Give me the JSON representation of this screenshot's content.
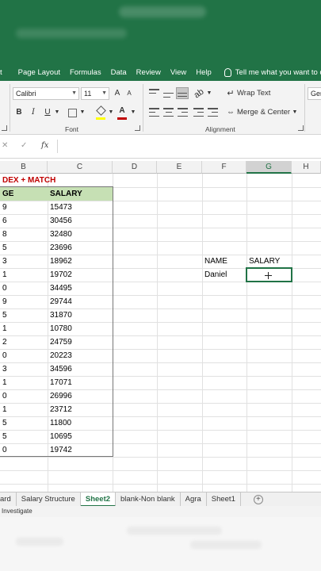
{
  "ribbon_tabs": [
    "t",
    "Page Layout",
    "Formulas",
    "Data",
    "Review",
    "View",
    "Help"
  ],
  "tell_me": "Tell me what you want to d",
  "font": {
    "name": "Calibri",
    "size": "11",
    "grow": "A",
    "shrink": "A",
    "bold": "B",
    "italic": "I",
    "underline": "U",
    "color_letter": "A",
    "group_label": "Font"
  },
  "alignment": {
    "wrap_text": "Wrap Text",
    "merge_center": "Merge & Center",
    "group_label": "Alignment",
    "number_format_partial": "Gen"
  },
  "formula_bar": {
    "fx": "fx",
    "cancel": "✕",
    "enter": "✓",
    "value": ""
  },
  "columns": [
    "B",
    "C",
    "D",
    "E",
    "F",
    "G",
    "H"
  ],
  "selected_column": "G",
  "sheet": {
    "title_cell": "DEX + MATCH",
    "headers": [
      "GE",
      "SALARY"
    ],
    "ages": [
      "9",
      "6",
      "8",
      "5",
      "3",
      "1",
      "0",
      "9",
      "5",
      "1",
      "2",
      "0",
      "3",
      "1",
      "0",
      "1",
      "5",
      "5",
      "0"
    ],
    "salaries": [
      "15473",
      "30456",
      "32480",
      "23696",
      "18962",
      "19702",
      "34495",
      "29744",
      "31870",
      "10780",
      "24759",
      "20223",
      "34596",
      "17071",
      "26996",
      "23712",
      "11800",
      "10695",
      "19742"
    ],
    "lookup": {
      "name_label": "NAME",
      "salary_label": "SALARY",
      "name_value": "Daniel",
      "salary_value": ""
    }
  },
  "sheet_tabs": [
    "ard",
    "Salary Structure",
    "Sheet2",
    "blank-Non blank",
    "Agra",
    "Sheet1"
  ],
  "active_sheet": "Sheet2",
  "status": "Investigate",
  "colors": {
    "excel_green": "#217346",
    "header_fill": "#c6e0b4",
    "title_red": "#c00000"
  }
}
